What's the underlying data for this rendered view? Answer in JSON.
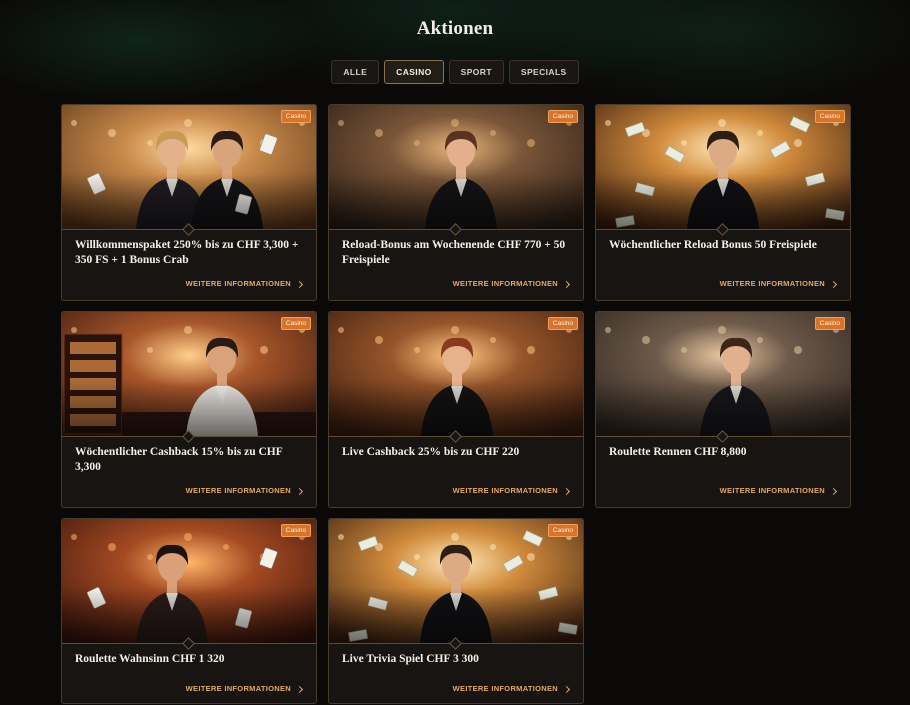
{
  "page": {
    "title": "Aktionen"
  },
  "filters": [
    {
      "label": "ALLE",
      "active": false
    },
    {
      "label": "CASINO",
      "active": true
    },
    {
      "label": "SPORT",
      "active": false
    },
    {
      "label": "SPECIALS",
      "active": false
    }
  ],
  "promotions": [
    {
      "badge": "Casino",
      "title": "Willkommenspaket 250% bis zu CHF 3,300 + 350 FS + 1 Bonus Crab",
      "cta": "WEITERE INFORMATIONEN",
      "scene": "couple-cards"
    },
    {
      "badge": "Casino",
      "title": "Reload-Bonus am Wochenende CHF 770 + 50 Freispiele",
      "cta": "WEITERE INFORMATIONEN",
      "scene": "woman-casino"
    },
    {
      "badge": "Casino",
      "title": "Wöchentlicher Reload Bonus 50 Freispiele",
      "cta": "WEITERE INFORMATIONEN",
      "scene": "man-money"
    },
    {
      "badge": "Casino",
      "title": "Wöchentlicher Cashback 15% bis zu CHF 3,300",
      "cta": "WEITERE INFORMATIONEN",
      "scene": "man-slots"
    },
    {
      "badge": "Casino",
      "title": "Live Cashback 25% bis zu CHF 220",
      "cta": "WEITERE INFORMATIONEN",
      "scene": "woman-redhair"
    },
    {
      "badge": "Casino",
      "title": "Roulette Rennen CHF 8,800",
      "cta": "WEITERE INFORMATIONEN",
      "scene": "woman-roulette"
    },
    {
      "badge": "Casino",
      "title": "Roulette Wahnsinn CHF 1 320",
      "cta": "WEITERE INFORMATIONEN",
      "scene": "woman-cards"
    },
    {
      "badge": "Casino",
      "title": "Live Trivia Spiel CHF 3 300",
      "cta": "WEITERE INFORMATIONEN",
      "scene": "man-money"
    }
  ],
  "colors": {
    "accent": "#e2a86b",
    "badge": "#d5742a",
    "card_border": "#4a3c2c",
    "background": "#0b0908"
  }
}
